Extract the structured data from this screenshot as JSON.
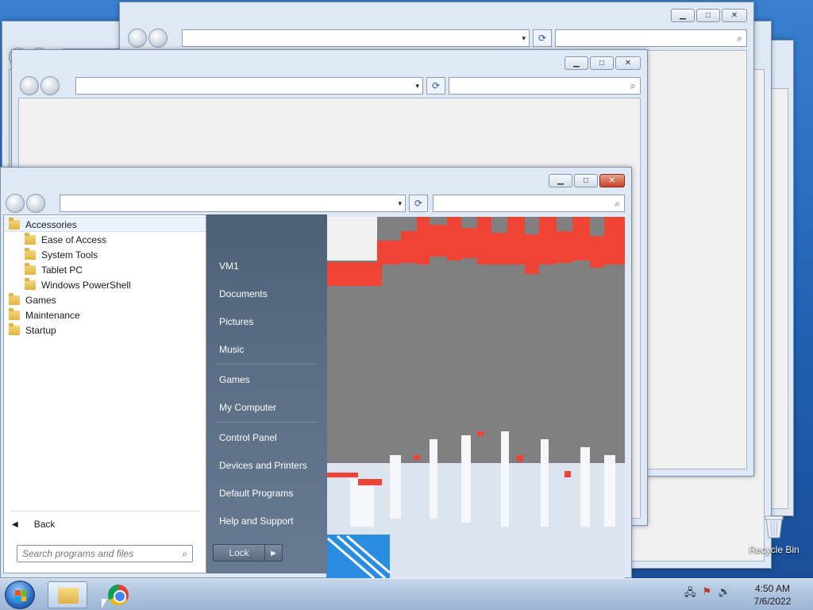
{
  "background_windows": [
    {
      "id": "w1",
      "controls": [
        "minimize",
        "maximize",
        "close"
      ]
    },
    {
      "id": "w2",
      "controls": [
        "minimize",
        "maximize",
        "close"
      ]
    },
    {
      "id": "w3",
      "controls": [
        "minimize",
        "maximize",
        "close"
      ]
    }
  ],
  "explorer": {
    "address_value": "",
    "search_value": "",
    "refresh_glyph": "⟳",
    "dropdown_glyph": "▾",
    "search_glyph": "⌕",
    "min_glyph": "▁",
    "max_glyph": "□",
    "close_glyph": "✕"
  },
  "start_menu": {
    "programs": [
      {
        "label": "Accessories",
        "level": 0
      },
      {
        "label": "Ease of Access",
        "level": 1
      },
      {
        "label": "System Tools",
        "level": 1
      },
      {
        "label": "Tablet PC",
        "level": 1
      },
      {
        "label": "Windows PowerShell",
        "level": 1
      },
      {
        "label": "Games",
        "level": 0
      },
      {
        "label": "Maintenance",
        "level": 0
      },
      {
        "label": "Startup",
        "level": 0
      }
    ],
    "back_label": "Back",
    "back_glyph": "◀",
    "search_placeholder": "Search programs and files",
    "right_items": [
      "VM1",
      "Documents",
      "Pictures",
      "Music",
      "Games",
      "My Computer",
      "Control Panel",
      "Devices and Printers",
      "Default Programs",
      "Help and Support"
    ],
    "lock_label": "Lock",
    "lock_arrow_glyph": "▶"
  },
  "desktop": {
    "recycle_bin_label": "Recycle Bin"
  },
  "taskbar": {
    "pinned": [
      "windows-explorer",
      "google-chrome"
    ],
    "tray_icons": [
      "network-icon",
      "action-center-flag-icon",
      "volume-icon"
    ],
    "tray_glyphs": [
      "🖧",
      "⚑",
      "🔊"
    ],
    "time": "4:50 AM",
    "date": "7/6/2022"
  },
  "colors": {
    "glitch_red": "#ef4336",
    "glitch_gray": "#808080",
    "glitch_blue": "#2a8de0"
  }
}
